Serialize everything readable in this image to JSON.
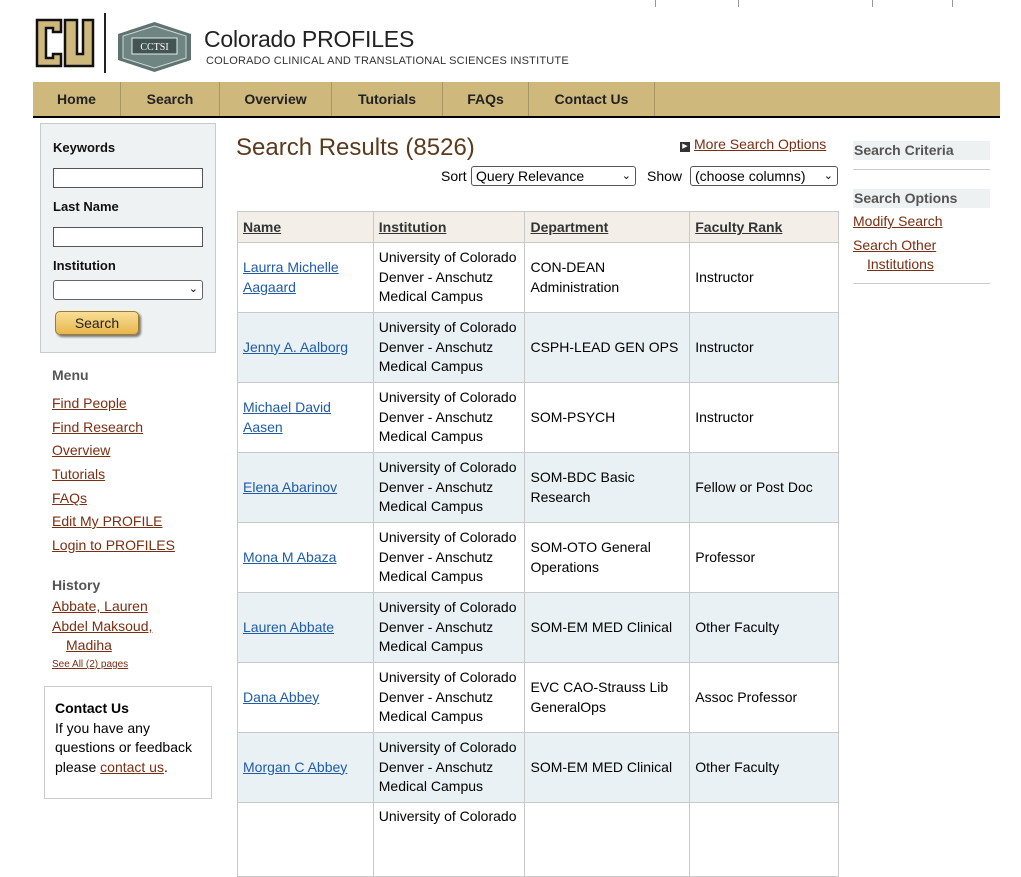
{
  "header": {
    "title": "Colorado PROFILES",
    "subtitle": "COLORADO CLINICAL AND TRANSLATIONAL SCIENCES INSTITUTE",
    "cctsi_logo_text": "CCTSI",
    "cu_logo_text": "CU"
  },
  "nav": [
    "Home",
    "Search",
    "Overview",
    "Tutorials",
    "FAQs",
    "Contact Us"
  ],
  "search_form": {
    "keywords_label": "Keywords",
    "lastname_label": "Last Name",
    "institution_label": "Institution",
    "institution_value": "",
    "search_button": "Search"
  },
  "menu": {
    "heading": "Menu",
    "items": [
      "Find People",
      "Find Research",
      "Overview",
      "Tutorials",
      "FAQs",
      "Edit My PROFILE",
      "Login to PROFILES"
    ]
  },
  "history": {
    "heading": "History",
    "items": [
      "Abbate, Lauren",
      "Abdel Maksoud,",
      "Madiha"
    ],
    "see_all": "See All (2) pages"
  },
  "contact": {
    "title": "Contact Us",
    "text": "If you have any questions or feedback please",
    "link": "contact us",
    "end": "."
  },
  "results": {
    "title": "Search Results (8526)",
    "more_options": "More Search Options",
    "sort_label": "Sort",
    "sort_value": "Query Relevance",
    "show_label": "Show",
    "show_value": "(choose columns)",
    "columns": [
      "Name",
      "Institution",
      "Department",
      "Faculty Rank"
    ],
    "rows": [
      {
        "name": "Laurra Michelle Aagaard",
        "institution": "University of Colorado Denver - Anschutz Medical Campus",
        "department": "CON-DEAN Administration",
        "rank": "Instructor"
      },
      {
        "name": "Jenny A. Aalborg",
        "institution": "University of Colorado Denver - Anschutz Medical Campus",
        "department": "CSPH-LEAD GEN OPS",
        "rank": "Instructor"
      },
      {
        "name": "Michael David Aasen",
        "institution": "University of Colorado Denver - Anschutz Medical Campus",
        "department": "SOM-PSYCH",
        "rank": "Instructor"
      },
      {
        "name": "Elena Abarinov",
        "institution": "University of Colorado Denver - Anschutz Medical Campus",
        "department": "SOM-BDC Basic Research",
        "rank": "Fellow or Post Doc"
      },
      {
        "name": "Mona M Abaza",
        "institution": "University of Colorado Denver - Anschutz Medical Campus",
        "department": "SOM-OTO General Operations",
        "rank": "Professor"
      },
      {
        "name": "Lauren Abbate",
        "institution": "University of Colorado Denver - Anschutz Medical Campus",
        "department": "SOM-EM MED Clinical",
        "rank": "Other Faculty"
      },
      {
        "name": "Dana Abbey",
        "institution": "University of Colorado Denver - Anschutz Medical Campus",
        "department": "EVC CAO-Strauss Lib GeneralOps",
        "rank": "Assoc Professor"
      },
      {
        "name": "Morgan C Abbey",
        "institution": "University of Colorado Denver - Anschutz Medical Campus",
        "department": "SOM-EM MED Clinical",
        "rank": "Other Faculty"
      },
      {
        "name": "",
        "institution": "University of Colorado",
        "department": "",
        "rank": ""
      }
    ]
  },
  "right_sidebar": {
    "criteria_heading": "Search Criteria",
    "options_heading": "Search Options",
    "modify_link": "Modify Search",
    "other_link_line1": "Search Other",
    "other_link_line2": "Institutions"
  },
  "colors": {
    "nav_background": "#cfb87c",
    "link_color": "#7a2e12",
    "name_link_color": "#1f5ba8",
    "row_alt": "#e9f1f5",
    "title_color": "#5b3a1e"
  }
}
